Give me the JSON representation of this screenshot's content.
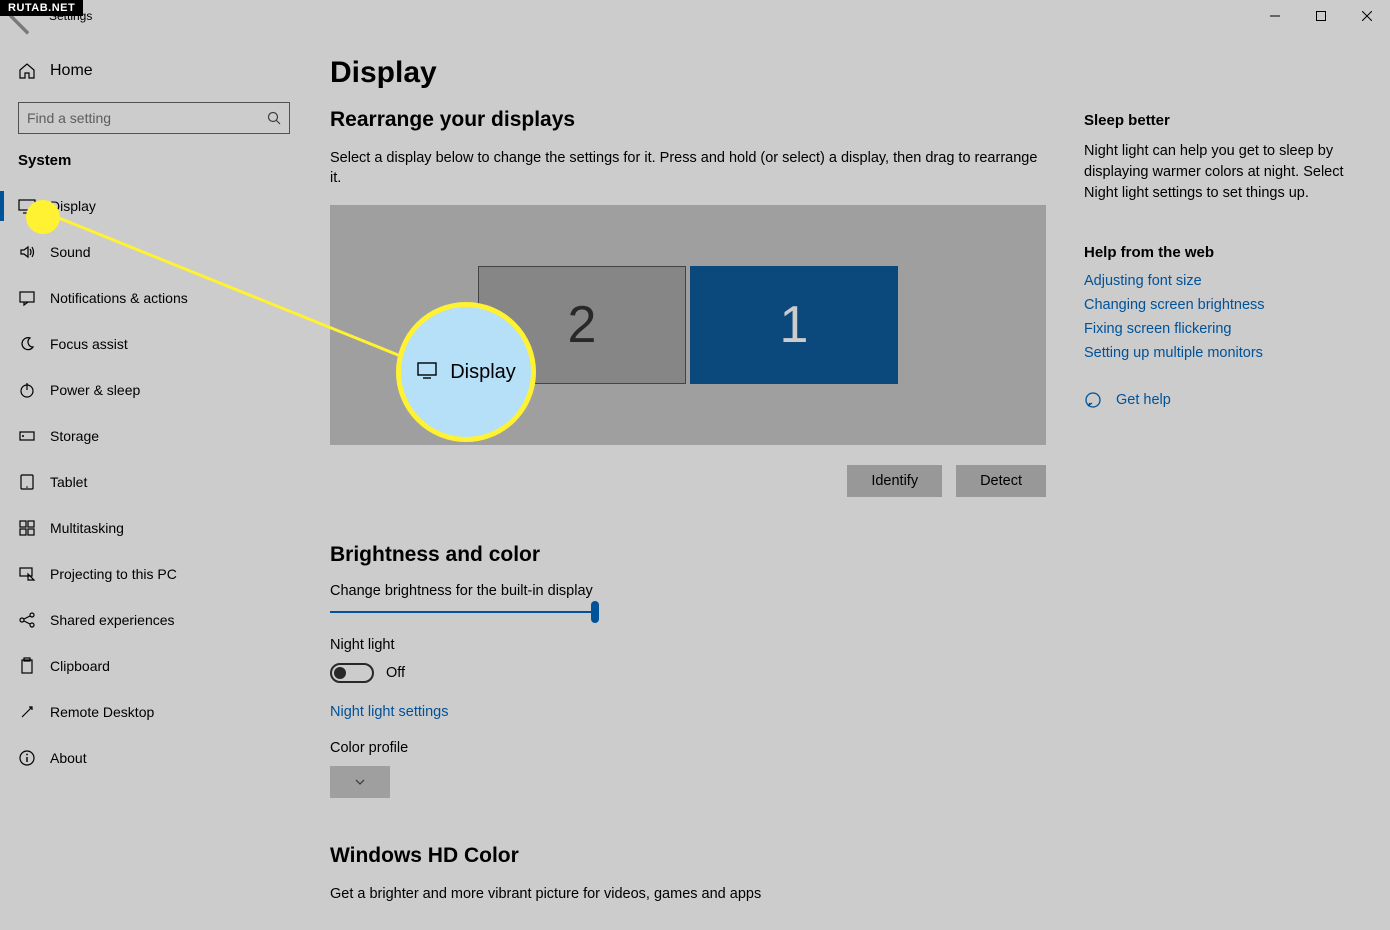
{
  "watermark": "RUTAB.NET",
  "app_title": "Settings",
  "sidebar": {
    "home_label": "Home",
    "search_placeholder": "Find a setting",
    "category": "System",
    "items": [
      {
        "label": "Display",
        "icon": "monitor"
      },
      {
        "label": "Sound",
        "icon": "sound"
      },
      {
        "label": "Notifications & actions",
        "icon": "chat"
      },
      {
        "label": "Focus assist",
        "icon": "moon"
      },
      {
        "label": "Power & sleep",
        "icon": "power"
      },
      {
        "label": "Storage",
        "icon": "storage"
      },
      {
        "label": "Tablet",
        "icon": "tablet"
      },
      {
        "label": "Multitasking",
        "icon": "multitask"
      },
      {
        "label": "Projecting to this PC",
        "icon": "project"
      },
      {
        "label": "Shared experiences",
        "icon": "share"
      },
      {
        "label": "Clipboard",
        "icon": "clipboard"
      },
      {
        "label": "Remote Desktop",
        "icon": "remote"
      },
      {
        "label": "About",
        "icon": "info"
      }
    ]
  },
  "page": {
    "title": "Display",
    "rearrange_title": "Rearrange your displays",
    "rearrange_sub": "Select a display below to change the settings for it. Press and hold (or select) a display, then drag to rearrange it.",
    "display2": "2",
    "display1": "1",
    "identify_btn": "Identify",
    "detect_btn": "Detect",
    "brightness_title": "Brightness and color",
    "brightness_label": "Change brightness for the built-in display",
    "nightlight_label": "Night light",
    "nightlight_state": "Off",
    "nightlight_link": "Night light settings",
    "colorprofile_label": "Color profile",
    "hdcolor_title": "Windows HD Color",
    "hdcolor_sub": "Get a brighter and more vibrant picture for videos, games and apps"
  },
  "aside": {
    "sleep_title": "Sleep better",
    "sleep_text": "Night light can help you get to sleep by displaying warmer colors at night. Select Night light settings to set things up.",
    "help_title": "Help from the web",
    "links": [
      "Adjusting font size",
      "Changing screen brightness",
      "Fixing screen flickering",
      "Setting up multiple monitors"
    ],
    "gethelp": "Get help"
  },
  "callout": {
    "label": "Display"
  }
}
